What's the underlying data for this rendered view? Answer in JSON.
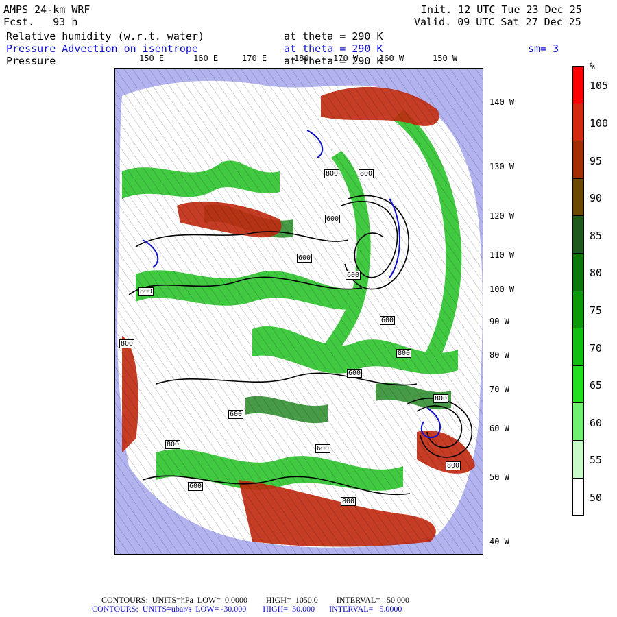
{
  "header": {
    "model": "AMPS 24-km WRF",
    "fcst": "Fcst.   93 h",
    "init": "Init. 12 UTC Tue 23 Dec 25",
    "valid": "Valid. 09 UTC Sat 27 Dec 25",
    "field1_name": "Relative humidity (w.r.t. water)",
    "field1_level": "at theta = 290 K",
    "field2_name": "Pressure Advection on isentrope",
    "field2_level": "at theta = 290 K",
    "field2_smooth": "sm= 3",
    "field3_name": "Pressure",
    "field3_level": "at theta = 290 K"
  },
  "map": {
    "top_lon_labels": [
      "150 E",
      "160 E",
      "170 E",
      "180",
      "170 W",
      "160 W",
      "150 W"
    ],
    "right_lat_labels": [
      "140 W",
      "130 W",
      "120 W",
      "110 W",
      "100 W",
      "90 W",
      "80 W",
      "70 W",
      "60 W",
      "50 W",
      "40 W"
    ],
    "contour_labels": [
      "800",
      "800",
      "600",
      "600",
      "600",
      "800",
      "600",
      "800",
      "800",
      "600",
      "800",
      "600",
      "800",
      "600",
      "800",
      "600",
      "800"
    ],
    "colors": {
      "ocean": "#b3b3f0",
      "high_rh": "#d42a10",
      "mid_rh": "#1fa01f",
      "low_rh": "#ffffff",
      "pressure_contour": "#000000",
      "advection_contour": "#1010d0"
    }
  },
  "colorbar": {
    "unit": "%",
    "labels": [
      "105",
      "100",
      "95",
      "90",
      "85",
      "80",
      "75",
      "70",
      "65",
      "60",
      "55",
      "50"
    ],
    "colors": [
      "#ff0000",
      "#d42a10",
      "#a33000",
      "#6b4a00",
      "#1e5a1e",
      "#0a7a0a",
      "#0a9a0a",
      "#10c010",
      "#20e020",
      "#70f070",
      "#c8fac8",
      "#ffffff"
    ]
  },
  "footer": {
    "line1": "CONTOURS:  UNITS=hPa  LOW=  0.0000         HIGH=  1050.0         INTERVAL=   50.000",
    "line2": "CONTOURS:  UNITS=ubar/s  LOW= -30.000        HIGH=  30.000       INTERVAL=   5.0000"
  }
}
